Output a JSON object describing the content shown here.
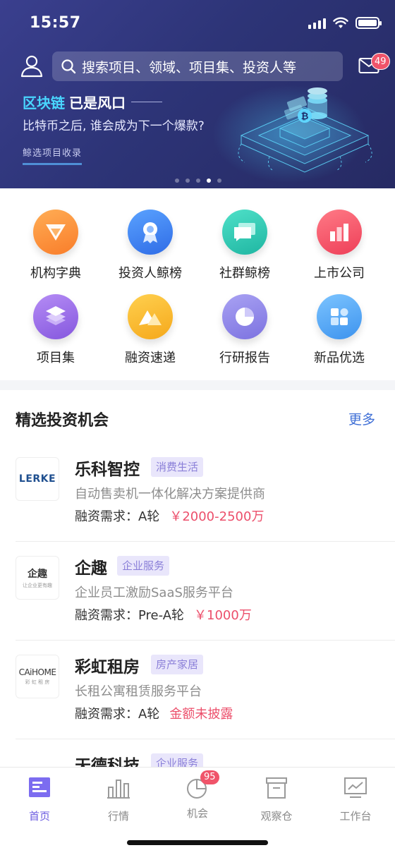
{
  "status_bar": {
    "time": "15:57"
  },
  "header": {
    "search_placeholder": "搜索项目、领域、项目集、投资人等",
    "mail_badge": "49",
    "icons": {
      "user": "user-icon",
      "search": "search-icon",
      "mail": "mail-icon"
    }
  },
  "banner": {
    "title_highlight": "区块链",
    "title_rest": "已是风口",
    "subtitle": "比特币之后, 谁会成为下一个爆款?",
    "tag": "鲸选项目收录",
    "active_dot": 4,
    "dot_count": 5
  },
  "shortcuts": [
    {
      "label": "机构字典",
      "icon": "diamond-icon",
      "color": "#fa8d3a"
    },
    {
      "label": "投资人鲸榜",
      "icon": "medal-icon",
      "color": "#3d86f0"
    },
    {
      "label": "社群鲸榜",
      "icon": "chat-icon",
      "color": "#2ec9b4"
    },
    {
      "label": "上市公司",
      "icon": "bar-chart-icon",
      "color": "#f2566a"
    },
    {
      "label": "项目集",
      "icon": "layers-icon",
      "color": "#9a6ee6"
    },
    {
      "label": "融资速递",
      "icon": "mountain-icon",
      "color": "#f8b72a"
    },
    {
      "label": "行研报告",
      "icon": "pie-chart-icon",
      "color": "#8f87e8"
    },
    {
      "label": "新品优选",
      "icon": "grid-icon",
      "color": "#4fa8f2"
    }
  ],
  "section": {
    "title": "精选投资机会",
    "more": "更多"
  },
  "opportunities": [
    {
      "name": "乐科智控",
      "tag": "消费生活",
      "desc": "自动售卖机一体化解决方案提供商",
      "round": "融资需求：A轮",
      "amount": "￥2000-2500万",
      "logo_text": "LERKE"
    },
    {
      "name": "企趣",
      "tag": "企业服务",
      "desc": "企业员工激励SaaS服务平台",
      "round": "融资需求：Pre-A轮",
      "amount": "￥1000万",
      "logo_text": "企趣",
      "logo_sub": "让企业更有趣"
    },
    {
      "name": "彩虹租房",
      "tag": "房产家居",
      "desc": "长租公寓租赁服务平台",
      "round": "融资需求：A轮",
      "amount": "金额未披露",
      "logo_text": "CAiHOME",
      "logo_sub": "彩 虹 租 房"
    },
    {
      "name": "天德科技",
      "tag": "企业服务"
    }
  ],
  "tabbar": [
    {
      "label": "首页",
      "icon": "home-icon",
      "active": true
    },
    {
      "label": "行情",
      "icon": "market-icon",
      "active": false
    },
    {
      "label": "机会",
      "icon": "opportunity-icon",
      "active": false,
      "badge": "95"
    },
    {
      "label": "观察仓",
      "icon": "watchlist-icon",
      "active": false
    },
    {
      "label": "工作台",
      "icon": "workbench-icon",
      "active": false
    }
  ]
}
